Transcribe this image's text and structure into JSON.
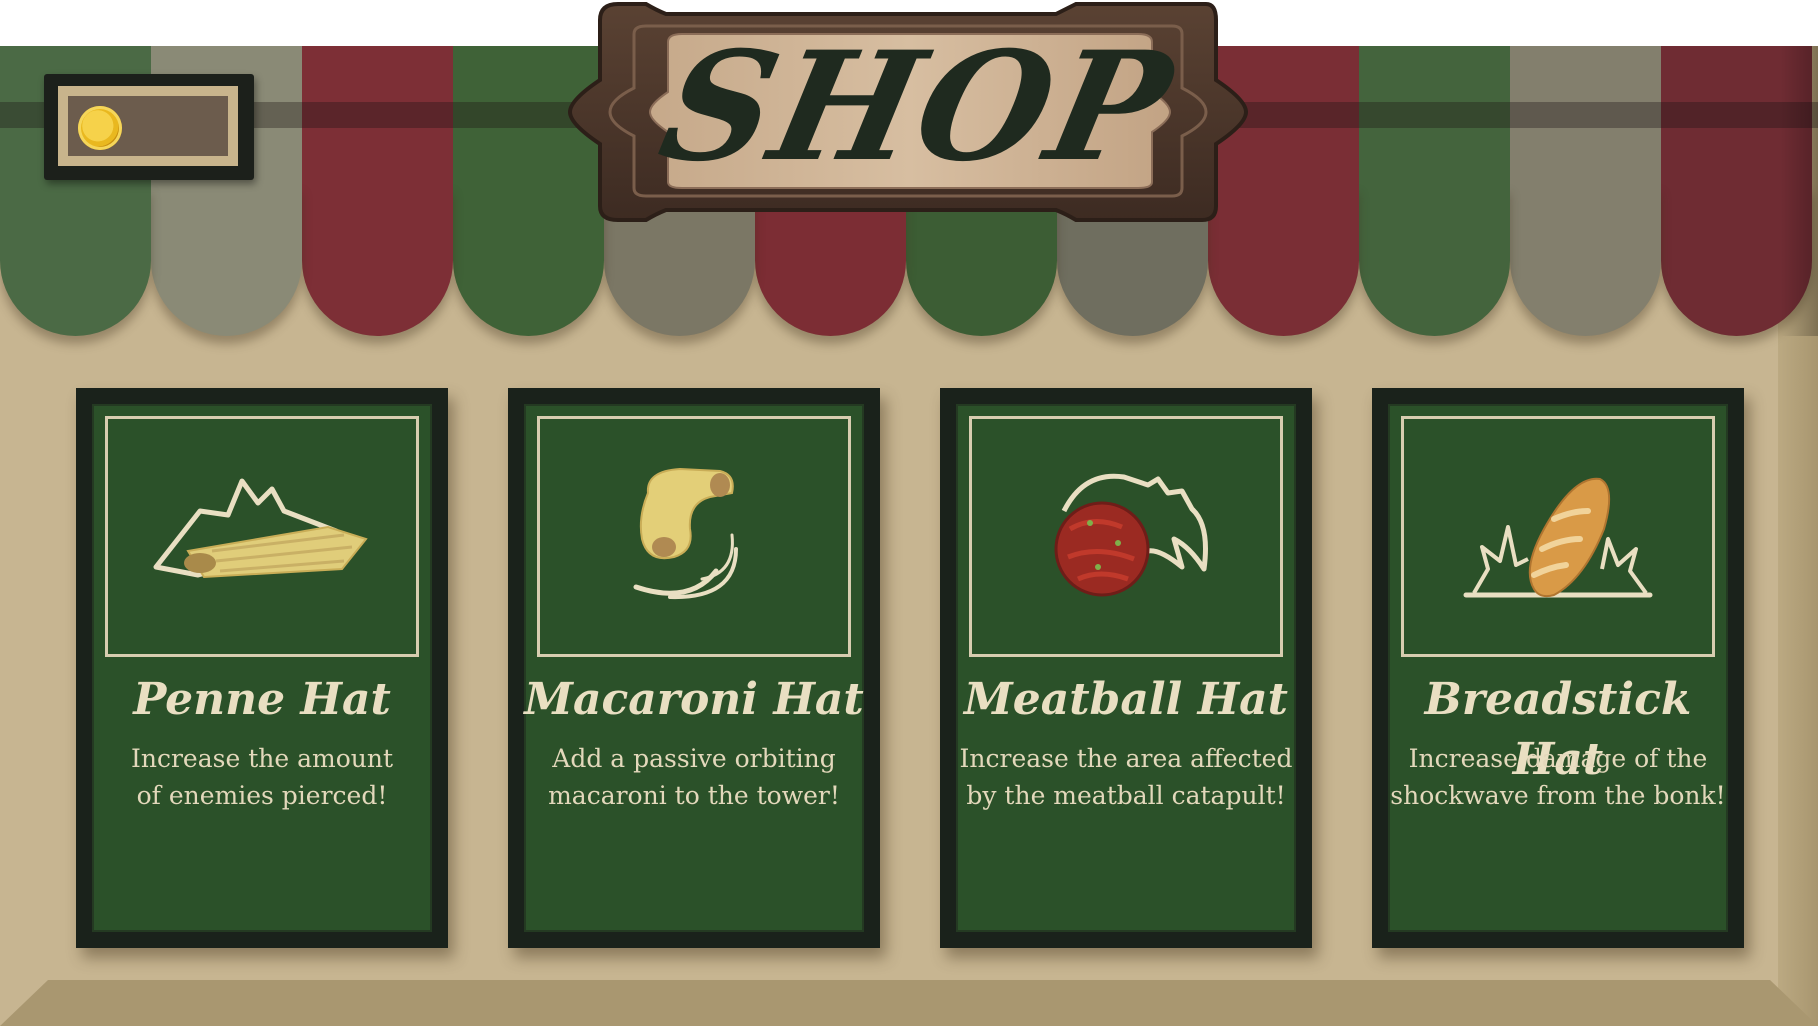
{
  "shop": {
    "title": "SHOP",
    "coins": ""
  },
  "awning": {
    "colors": [
      "#4b6a45",
      "#8a8a76",
      "#7d2f36",
      "#3f6237",
      "#7b7765",
      "#7c2d34",
      "#3c5d34",
      "#6f6e5f",
      "#7a2e35",
      "#44643d",
      "#837f6d",
      "#6f2c33"
    ]
  },
  "cards": [
    {
      "name": "Penne Hat",
      "description": "Increase the amount\nof enemies pierced!",
      "icon": "penne-icon"
    },
    {
      "name": "Macaroni Hat",
      "description": "Add a passive orbiting\nmacaroni to the tower!",
      "icon": "macaroni-icon"
    },
    {
      "name": "Meatball Hat",
      "description": "Increase the area affected\nby the meatball catapult!",
      "icon": "meatball-icon"
    },
    {
      "name": "Breadstick Hat",
      "description": "Increase damage of the\nshockwave from the bonk!",
      "icon": "breadstick-icon"
    }
  ],
  "colors": {
    "card_green": "#2b5129",
    "card_border": "#1a221b",
    "cream": "#e9dfc2",
    "wall": "#c7b591"
  }
}
